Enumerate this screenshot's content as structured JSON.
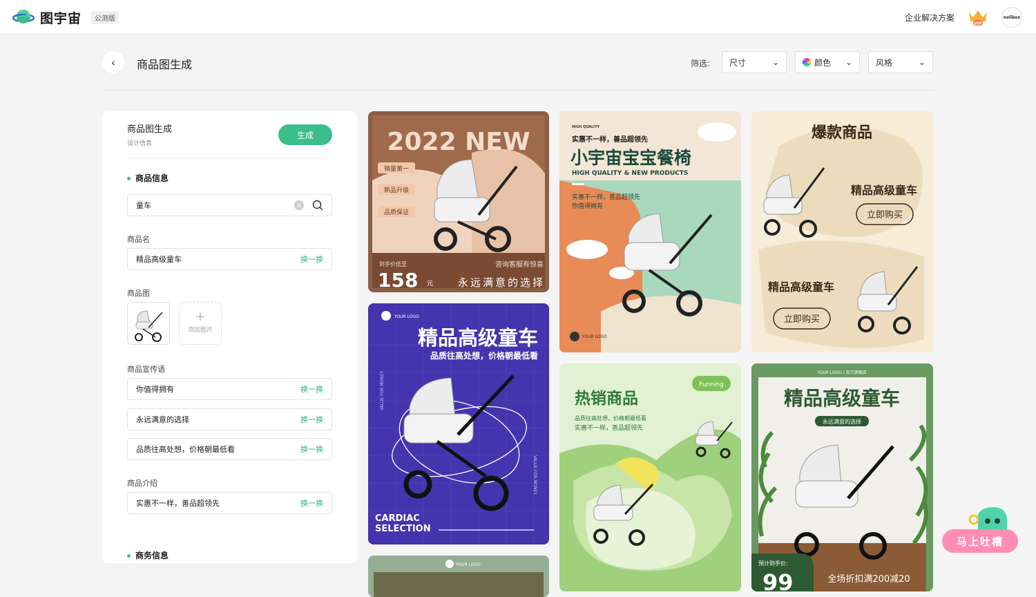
{
  "topbar": {
    "logo_text": "图宇宙",
    "beta_badge": "公测版",
    "enterprise_link": "企业解决方案",
    "vip_badge": "VIP",
    "avatar_text": "nolibox"
  },
  "header": {
    "title": "商品图生成",
    "filter_label": "筛选:",
    "filters": [
      "尺寸",
      "颜色",
      "风格"
    ]
  },
  "panel": {
    "title": "商品图生成",
    "subtitle": "设计信息",
    "generate_button": "生成",
    "product_info_section": "商品信息",
    "search_value": "童车",
    "product_name_label": "商品名",
    "product_name_value": "精品高级童车",
    "swap_label": "换一换",
    "product_image_label": "商品图",
    "add_image_label": "添加图片",
    "slogan_label": "商品宣传语",
    "slogans": [
      "你值得拥有",
      "永远满意的选择",
      "品质往高处想，价格朝最低看"
    ],
    "intro_label": "商品介绍",
    "intro_value": "实惠不一样，善品超领先",
    "business_section": "商务信息"
  },
  "cards": {
    "c1": {
      "headline": "2022 NEW",
      "tags": [
        "销量第一",
        "新品升级",
        "品质保证"
      ],
      "price_label": "到手价低至",
      "price": "158",
      "price_unit": "元",
      "service": "咨询客服有惊喜",
      "slogan": "永远满意的选择"
    },
    "c2": {
      "tag": "HIGH QUALITY",
      "line1": "实惠不一样，善品超领先",
      "title": "小宇宙宝宝餐椅",
      "subtitle": "HIGH QUALITY & NEW PRODUCTS",
      "desc1": "实惠不一样，善品超领先",
      "desc2": "你值得拥有",
      "logo": "YOUR LOGO"
    },
    "c3": {
      "title": "爆款商品",
      "name1": "精品高级童车",
      "cta1": "立即购买",
      "name2": "精品高级童车",
      "cta2": "立即购买"
    },
    "c4": {
      "logo": "YOUR LOGO",
      "title": "精品高级童车",
      "subtitle": "品质往高处想，价格朝最低看",
      "side": "VALUE FOR MONEY",
      "bottom1": "CARDIAC",
      "bottom2": "SELECTION"
    },
    "c5": {
      "badge": "Funning",
      "title": "热销商品",
      "desc1": "品质往高处想，价格朝最低看",
      "desc2": "实惠不一样，善品超领先"
    },
    "c6": {
      "top": "YOUR LOGO | 官方旗舰店",
      "title": "精品高级童车",
      "pill": "永远满意的选择",
      "price_label": "预计到手价:",
      "price": "99",
      "promo": "全场折扣满200减20"
    },
    "c7": {
      "logo": "YOUR LOGO"
    }
  },
  "floating": {
    "label": "马上吐槽"
  },
  "colors": {
    "accent": "#3cbd8c",
    "feedback": "#ff8eb2"
  }
}
